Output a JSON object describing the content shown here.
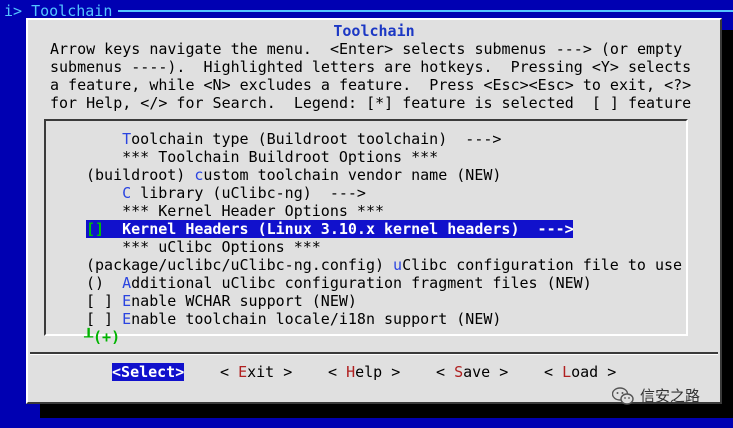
{
  "banner": {
    "title": "i> Toolchain"
  },
  "dialog": {
    "title": "Toolchain",
    "help_lines": [
      "Arrow keys navigate the menu.  <Enter> selects submenus ---> (or empty",
      "submenus ----).  Highlighted letters are hotkeys.  Pressing <Y> selects",
      "a feature, while <N> excludes a feature.  Press <Esc><Esc> to exit, <?>",
      "for Help, </> for Search.  Legend: [*] feature is selected  [ ] feature"
    ]
  },
  "menu": {
    "items": [
      {
        "prefix": "    ",
        "hotkey": "T",
        "rest": "oolchain type (Buildroot toolchain)  --->"
      },
      {
        "prefix": "    ",
        "hotkey": "",
        "rest": "*** Toolchain Buildroot Options ***"
      },
      {
        "prefix": "(buildroot) ",
        "hotkey": "c",
        "rest": "ustom toolchain vendor name (NEW)"
      },
      {
        "prefix": "    ",
        "hotkey": "C",
        "rest": " library (uClibc-ng)  --->"
      },
      {
        "prefix": "    ",
        "hotkey": "",
        "rest": "*** Kernel Header Options ***"
      },
      {
        "prefix": "[]  ",
        "hotkey": "K",
        "rest": "ernel Headers (Linux 3.10.x kernel headers)  --->"
      },
      {
        "prefix": "    ",
        "hotkey": "",
        "rest": "*** uClibc Options ***"
      },
      {
        "prefix": "(package/uclibc/uClibc-ng.config) ",
        "hotkey": "u",
        "rest": "Clibc configuration file to use"
      },
      {
        "prefix": "()  ",
        "hotkey": "A",
        "rest": "dditional uClibc configuration fragment files (NEW)"
      },
      {
        "prefix": "[ ] ",
        "hotkey": "E",
        "rest": "nable WCHAR support (NEW)"
      },
      {
        "prefix": "[ ] ",
        "hotkey": "E",
        "rest": "nable toolchain locale/i18n support (NEW)"
      }
    ],
    "more_indicator": "┸(+)"
  },
  "buttons": [
    {
      "pre": "<",
      "hotkey": "S",
      "post": "elect>"
    },
    {
      "pre": "< ",
      "hotkey": "E",
      "post": "xit >"
    },
    {
      "pre": "< ",
      "hotkey": "H",
      "post": "elp >"
    },
    {
      "pre": "< ",
      "hotkey": "S",
      "post": "ave >"
    },
    {
      "pre": "< ",
      "hotkey": "L",
      "post": "oad >"
    }
  ],
  "watermark": {
    "text": "信安之路",
    "icon": "wechat-icon"
  }
}
